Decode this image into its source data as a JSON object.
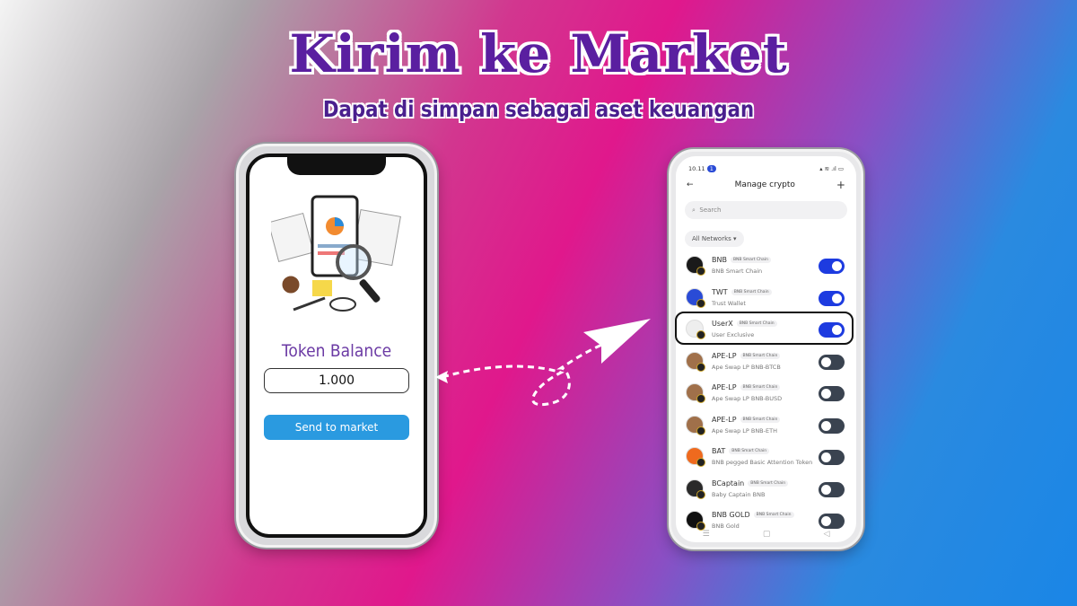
{
  "banner": {
    "title": "Kirim ke Market",
    "subtitle": "Dapat di simpan sebagai aset keuangan"
  },
  "left_phone": {
    "label": "Token Balance",
    "balance_value": "1.000",
    "send_button": "Send to market"
  },
  "right_phone": {
    "status": {
      "time": "10.11",
      "badge": "1"
    },
    "header": {
      "title": "Manage crypto",
      "back_icon": "←",
      "add_icon": "+"
    },
    "search": {
      "placeholder": "Search"
    },
    "network_filter": "All Networks ▾",
    "tokens": [
      {
        "name": "BNB",
        "network": "BNB Smart Chain",
        "subtitle": "BNB Smart Chain",
        "enabled": true,
        "color": "#1a1a1a"
      },
      {
        "name": "TWT",
        "network": "BNB Smart Chain",
        "subtitle": "Trust Wallet",
        "enabled": true,
        "color": "#2a4bd6"
      },
      {
        "name": "UserX",
        "network": "BNB Smart Chain",
        "subtitle": "User Exclusive",
        "enabled": true,
        "color": "#eeeeee"
      },
      {
        "name": "APE-LP",
        "network": "BNB Smart Chain",
        "subtitle": "Ape Swap LP BNB-BTCB",
        "enabled": false,
        "color": "#a0704a"
      },
      {
        "name": "APE-LP",
        "network": "BNB Smart Chain",
        "subtitle": "Ape Swap LP BNB-BUSD",
        "enabled": false,
        "color": "#a0704a"
      },
      {
        "name": "APE-LP",
        "network": "BNB Smart Chain",
        "subtitle": "Ape Swap LP BNB-ETH",
        "enabled": false,
        "color": "#a0704a"
      },
      {
        "name": "BAT",
        "network": "BNB Smart Chain",
        "subtitle": "BNB pegged Basic Attention Token",
        "enabled": false,
        "color": "#ef6a1e"
      },
      {
        "name": "BCaptain",
        "network": "BNB Smart Chain",
        "subtitle": "Baby Captain BNB",
        "enabled": false,
        "color": "#2a2a2a"
      },
      {
        "name": "BNB GOLD",
        "network": "BNB Smart Chain",
        "subtitle": "BNB Gold",
        "enabled": false,
        "color": "#111111"
      }
    ],
    "nav": [
      "☰",
      "▢",
      "◁"
    ]
  }
}
